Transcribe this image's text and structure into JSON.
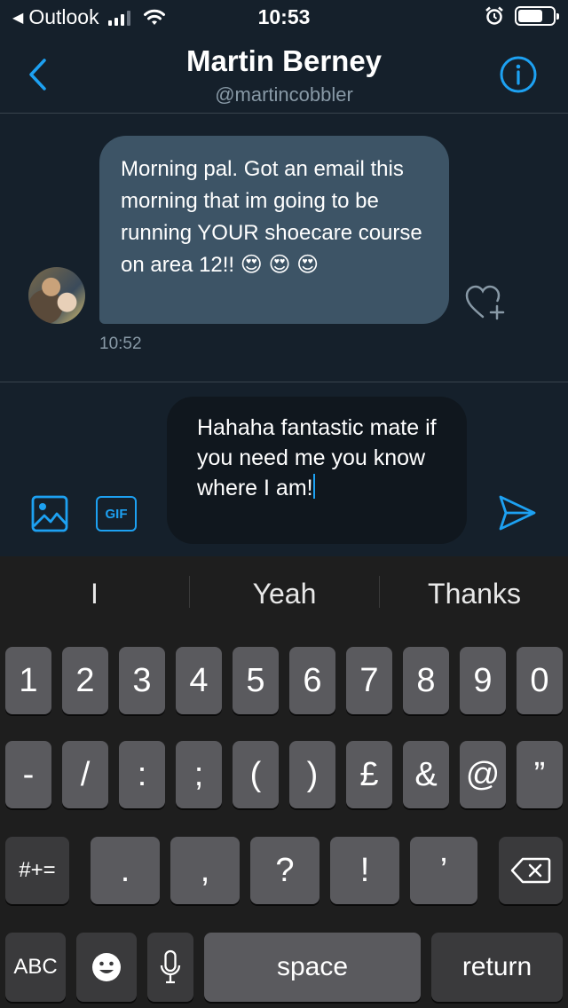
{
  "status_bar": {
    "back_app": "Outlook",
    "time": "10:53"
  },
  "header": {
    "title": "Martin Berney",
    "handle": "@martincobbler"
  },
  "messages": [
    {
      "text": "Morning pal. Got an email this morning that im going to be running YOUR shoecare course on area 12!! 😍 😍 😍",
      "time": "10:52"
    }
  ],
  "composer": {
    "gif_label": "GIF",
    "draft": "Hahaha fantastic mate if you need me you know where I am!"
  },
  "keyboard": {
    "suggestions": [
      "I",
      "Yeah",
      "Thanks"
    ],
    "row1": [
      "1",
      "2",
      "3",
      "4",
      "5",
      "6",
      "7",
      "8",
      "9",
      "0"
    ],
    "row2": [
      "-",
      "/",
      ":",
      ";",
      "(",
      ")",
      "£",
      "&",
      "@",
      "”"
    ],
    "row3": [
      ".",
      ",",
      "?",
      "!",
      "’"
    ],
    "symbols_key": "#+=",
    "abc_key": "ABC",
    "space_key": "space",
    "return_key": "return"
  },
  "colors": {
    "background": "#15202b",
    "accent": "#1da1f2",
    "incoming_bubble": "#3d5466",
    "secondary_text": "#8899a6"
  },
  "icons": [
    "back-chevron-icon",
    "info-icon",
    "heart-plus-icon",
    "photo-icon",
    "gif-icon",
    "send-icon",
    "backspace-icon",
    "emoji-icon",
    "microphone-icon"
  ]
}
